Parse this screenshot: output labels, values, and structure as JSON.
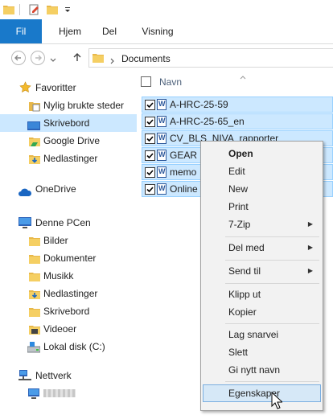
{
  "ribbon": {
    "tabs": [
      "Fil",
      "Hjem",
      "Del",
      "Visning"
    ]
  },
  "address": {
    "path": "Documents"
  },
  "nav": {
    "favorites_label": "Favoritter",
    "favorites": [
      "Nylig brukte steder",
      "Skrivebord",
      "Google Drive",
      "Nedlastinger"
    ],
    "onedrive_label": "OneDrive",
    "pc_label": "Denne PCen",
    "pc_items": [
      "Bilder",
      "Dokumenter",
      "Musikk",
      "Nedlastinger",
      "Skrivebord",
      "Videoer",
      "Lokal disk (C:)"
    ],
    "network_label": "Nettverk"
  },
  "list": {
    "column_name": "Navn",
    "files": [
      "A-HRC-25-59",
      "A-HRC-25-65_en",
      "CV_BLS_NIVA_rapporter",
      "GEAR",
      "memo",
      "Online"
    ]
  },
  "context_menu": {
    "items": [
      "Open",
      "Edit",
      "New",
      "Print",
      "7-Zip",
      "Del med",
      "Send til",
      "Klipp ut",
      "Kopier",
      "Lag snarvei",
      "Slett",
      "Gi nytt navn",
      "Egenskaper"
    ]
  },
  "colors": {
    "accent": "#1979ca",
    "selection": "#cce8ff",
    "menu_bg": "#f2f2f2"
  }
}
